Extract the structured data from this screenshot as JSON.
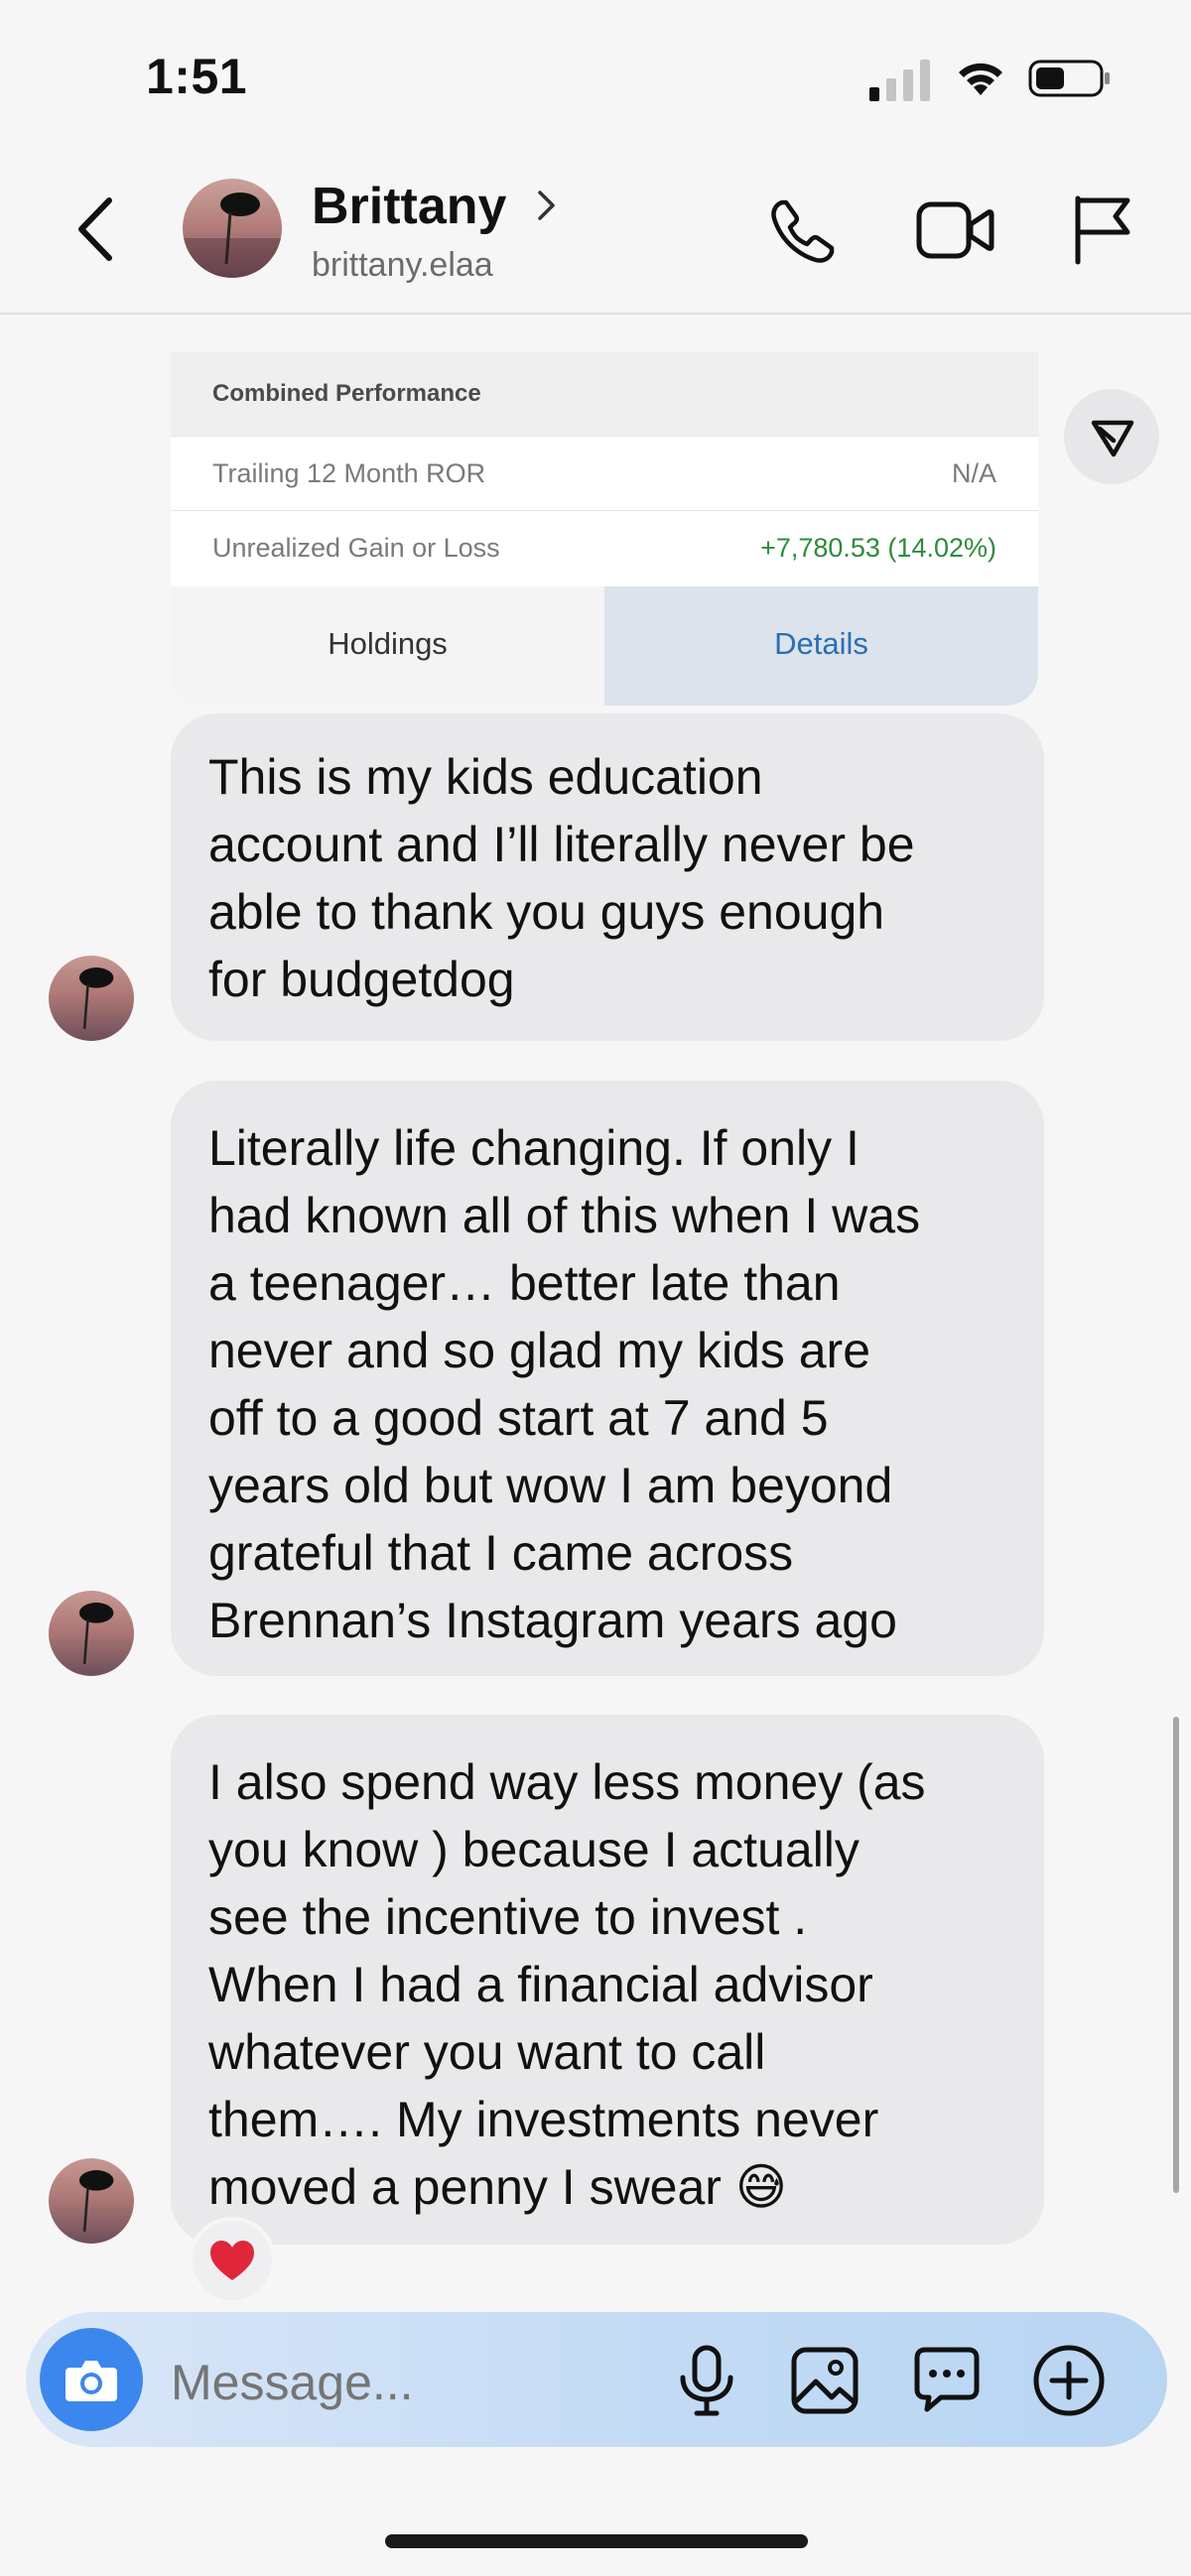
{
  "status_bar": {
    "time": "1:51"
  },
  "header": {
    "name": "Brittany",
    "username": "brittany.elaa"
  },
  "shared_card": {
    "section_title": "Combined Performance",
    "rows": [
      {
        "label": "Trailing 12 Month ROR",
        "value": "N/A"
      },
      {
        "label": "Unrealized Gain or Loss",
        "value": "+7,780.53 (14.02%)"
      }
    ],
    "tabs": {
      "holdings": "Holdings",
      "details": "Details"
    }
  },
  "messages": [
    {
      "lines": [
        "This is my kids education",
        "account and I’ll literally never be",
        "able to thank you guys enough",
        "for budgetdog"
      ]
    },
    {
      "lines": [
        "Literally life changing. If only I",
        "had known all of this when I was",
        "a teenager… better late than",
        "never and so glad my kids are",
        "off to a good start at 7 and 5",
        "years old but wow I am beyond",
        "grateful that I came across",
        "Brennan’s Instagram years ago"
      ]
    },
    {
      "lines": [
        "I also spend way less money (as",
        "you know ) because I actually",
        "see the incentive to invest .",
        "When I had a financial advisor",
        "whatever you want to call",
        "them…. My investments never",
        "moved a penny I swear 😅"
      ]
    }
  ],
  "reaction": "❤️",
  "composer": {
    "placeholder": "Message..."
  },
  "colors": {
    "accent": "#3b87ee",
    "gain": "#2e8b3c",
    "bubble": "#e9e9eb"
  }
}
